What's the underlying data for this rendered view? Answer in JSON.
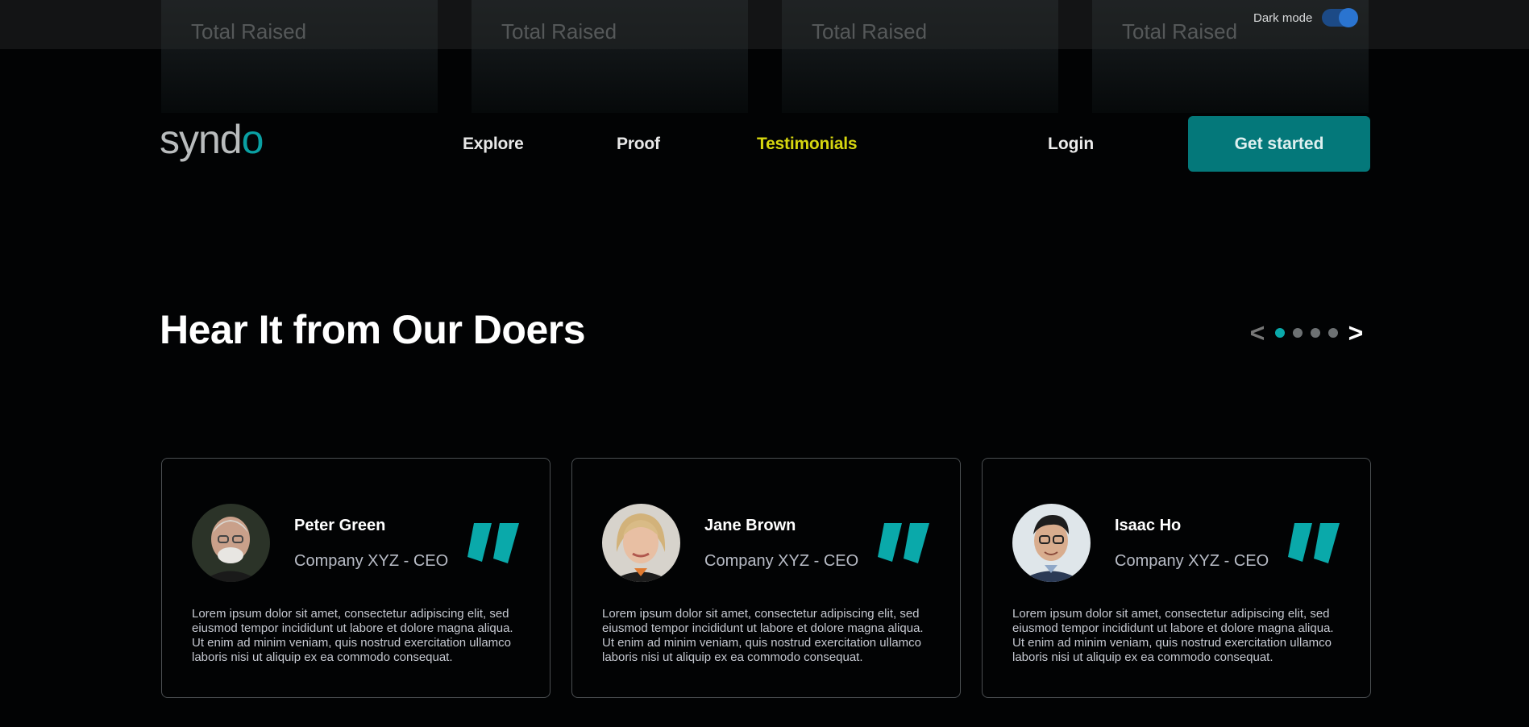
{
  "stats": [
    {
      "label": "Total Raised"
    },
    {
      "label": "Total Raised"
    },
    {
      "label": "Total Raised"
    },
    {
      "label": "Total Raised"
    }
  ],
  "dark_mode": {
    "label": "Dark mode",
    "enabled": true
  },
  "brand": {
    "logo_text": "syndo",
    "accent": "#04787a",
    "highlight": "#d6d60f"
  },
  "nav": {
    "links": [
      {
        "label": "Explore"
      },
      {
        "label": "Proof"
      },
      {
        "label": "Testimonials"
      }
    ],
    "login": "Login",
    "cta": "Get started"
  },
  "section": {
    "title": "Hear It from Our Doers",
    "prev_icon": "chevron-left",
    "next_icon": "chevron-right",
    "page_count": 4,
    "current_page": 1
  },
  "testimonials": [
    {
      "name": "Peter Green",
      "role": "Company XYZ - CEO",
      "text": "Lorem ipsum dolor sit amet, consectetur adipiscing elit, sed eiusmod tempor incididunt ut labore et dolore magna aliqua. Ut enim ad minim veniam, quis nostrud exercitation ullamco laboris nisi ut aliquip ex ea commodo consequat."
    },
    {
      "name": "Jane Brown",
      "role": "Company XYZ - CEO",
      "text": "Lorem ipsum dolor sit amet, consectetur adipiscing elit, sed eiusmod tempor incididunt ut labore et dolore magna aliqua. Ut enim ad minim veniam, quis nostrud exercitation ullamco laboris nisi ut aliquip ex ea commodo consequat."
    },
    {
      "name": "Isaac Ho",
      "role": "Company XYZ - CEO",
      "text": "Lorem ipsum dolor sit amet, consectetur adipiscing elit, sed eiusmod tempor incididunt ut labore et dolore magna aliqua. Ut enim ad minim veniam, quis nostrud exercitation ullamco laboris nisi ut aliquip ex ea commodo consequat."
    }
  ]
}
